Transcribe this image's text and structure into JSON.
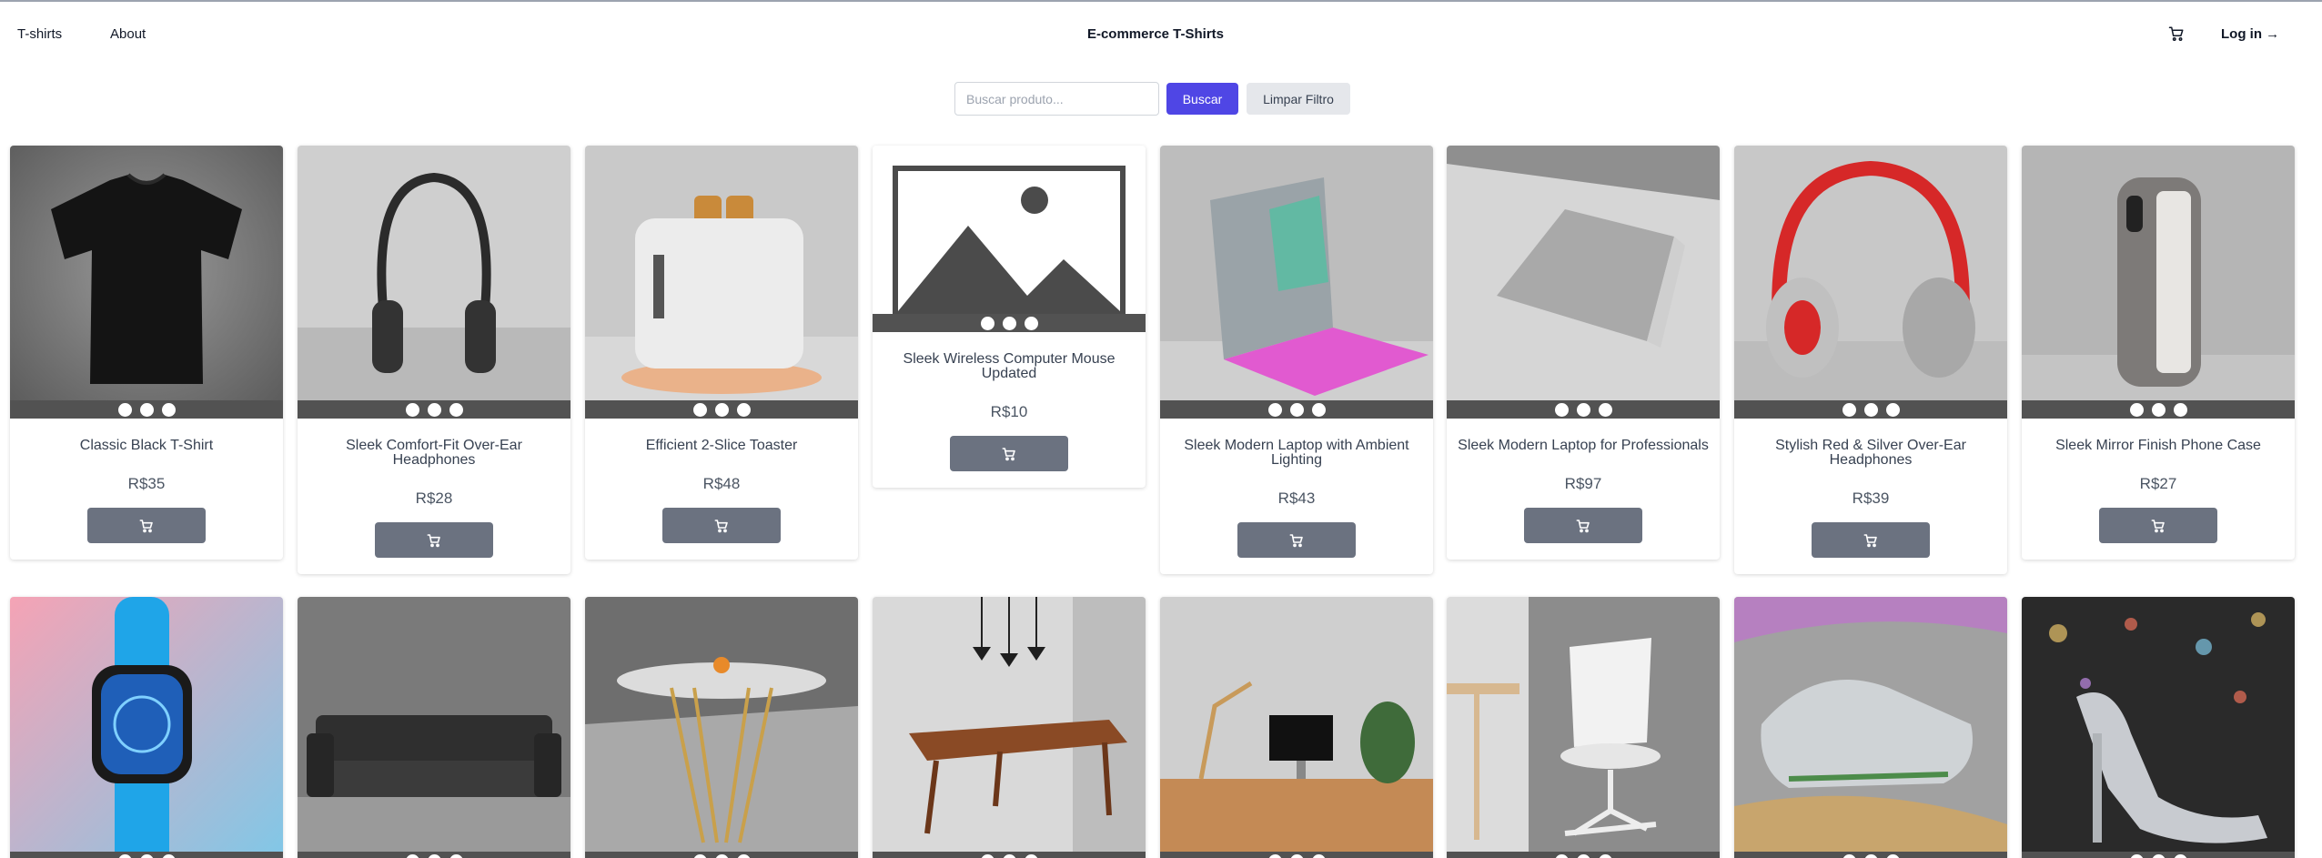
{
  "nav": {
    "tshirts_label": "T-shirts",
    "about_label": "About",
    "site_title": "E-commerce T-Shirts",
    "cart_icon": "cart-icon",
    "login_label": "Log in →"
  },
  "search": {
    "placeholder": "Buscar produto...",
    "value": "",
    "search_label": "Buscar",
    "clear_label": "Limpar Filtro"
  },
  "colors": {
    "primary": "#4f46e5",
    "cart_button": "#6b7280",
    "image_nav_bar": "#525252"
  },
  "products": [
    {
      "title": "Classic Black T-Shirt",
      "price": "R$35"
    },
    {
      "title": "Sleek Comfort-Fit Over-Ear Headphones",
      "price": "R$28"
    },
    {
      "title": "Efficient 2-Slice Toaster",
      "price": "R$48"
    },
    {
      "title": "Sleek Wireless Computer Mouse Updated",
      "price": "R$10"
    },
    {
      "title": "Sleek Modern Laptop with Ambient Lighting",
      "price": "R$43"
    },
    {
      "title": "Sleek Modern Laptop for Professionals",
      "price": "R$97"
    },
    {
      "title": "Stylish Red & Silver Over-Ear Headphones",
      "price": "R$39"
    },
    {
      "title": "Sleek Mirror Finish Phone Case",
      "price": "R$27"
    },
    {
      "title": "",
      "price": ""
    },
    {
      "title": "",
      "price": ""
    },
    {
      "title": "",
      "price": ""
    },
    {
      "title": "",
      "price": ""
    },
    {
      "title": "",
      "price": ""
    },
    {
      "title": "",
      "price": ""
    },
    {
      "title": "",
      "price": ""
    },
    {
      "title": "",
      "price": ""
    }
  ]
}
